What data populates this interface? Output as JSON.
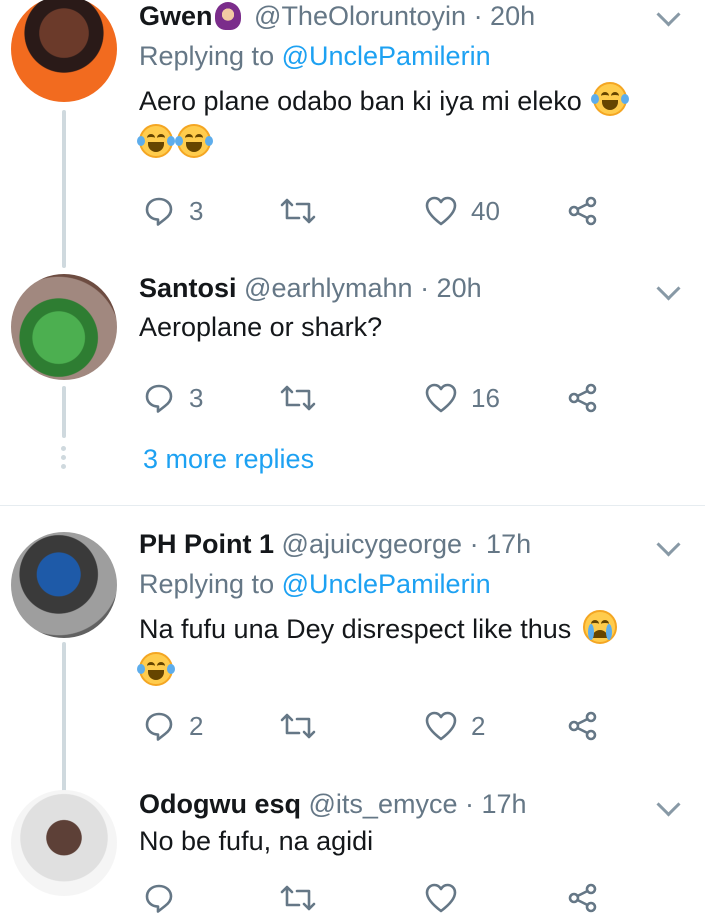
{
  "tweets": [
    {
      "name": "Gwen",
      "handle": "@TheOloruntoyin",
      "time": "· 20h",
      "replying_label": "Replying to",
      "replying_to": "@UnclePamilerin",
      "text_line1": "Aero plane odabo ban ki iya mi eleko",
      "replies": "3",
      "retweets": "",
      "likes": "40"
    },
    {
      "name": "Santosi",
      "handle": "@earhlymahn",
      "time": "· 20h",
      "text_line1": "Aeroplane or shark?",
      "replies": "3",
      "retweets": "",
      "likes": "16"
    },
    {
      "name": "PH Point 1",
      "handle": "@ajuicygeorge",
      "time": "· 17h",
      "replying_label": "Replying to",
      "replying_to": "@UnclePamilerin",
      "text_line1": "Na fufu una Dey disrespect like thus",
      "replies": "2",
      "retweets": "",
      "likes": "2"
    },
    {
      "name": "Odogwu esq",
      "handle": "@its_emyce",
      "time": "· 17h",
      "text_line1": "No be fufu, na agidi",
      "replies": "",
      "retweets": "",
      "likes": ""
    }
  ],
  "more_replies": "3 more replies",
  "icons": [
    "reply-icon",
    "retweet-icon",
    "like-icon",
    "share-icon",
    "chevron-down-icon",
    "emoji-laughing-icon",
    "emoji-crying-icon",
    "emoji-hijab-icon"
  ],
  "colors": {
    "link": "#1da1f2",
    "muted": "#657786",
    "text": "#14171a",
    "line": "#cfd9de"
  }
}
